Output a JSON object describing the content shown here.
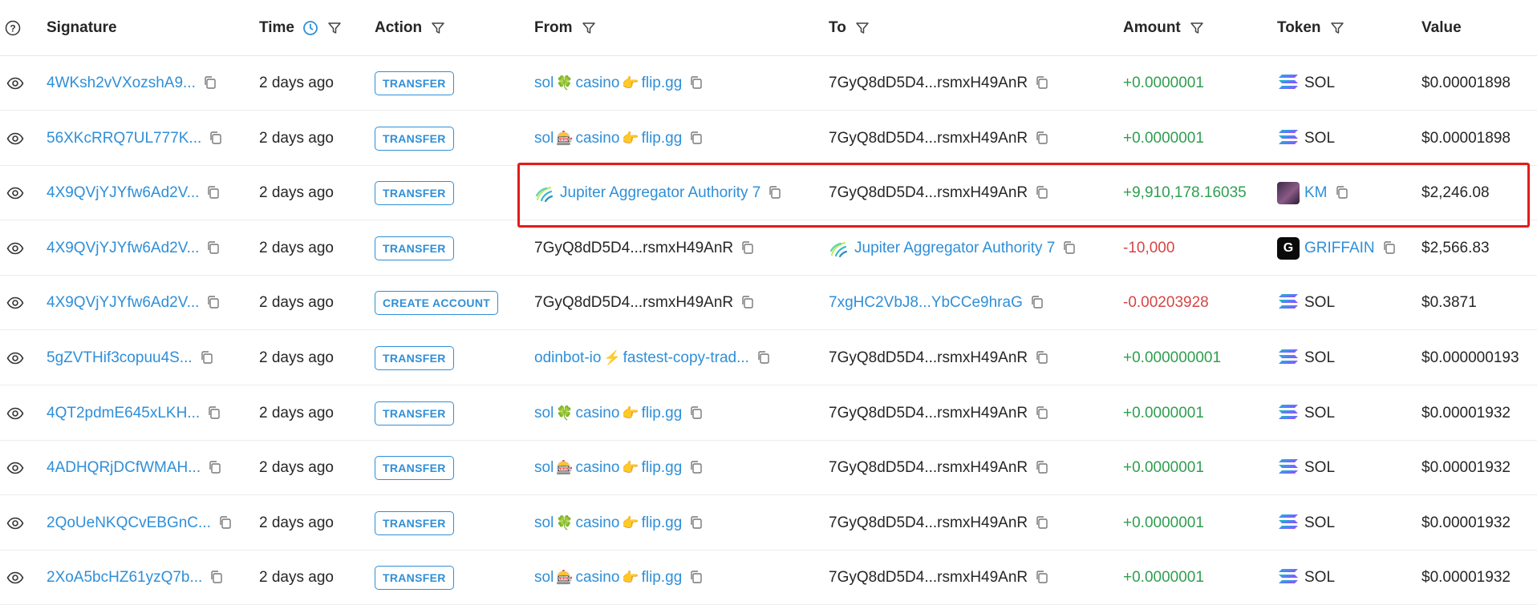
{
  "columns": {
    "signature": "Signature",
    "time": "Time",
    "action": "Action",
    "from": "From",
    "to": "To",
    "amount": "Amount",
    "token": "Token",
    "value": "Value"
  },
  "rows": [
    {
      "signature": "4WKsh2vVXozshA9...",
      "time": "2 days ago",
      "action": "TRANSFER",
      "from": {
        "parts": [
          "sol",
          "🍀",
          "casino",
          "👉",
          "flip.gg"
        ],
        "link": true
      },
      "to": {
        "text": "7GyQ8dD5D4...rsmxH49AnR",
        "link": false
      },
      "amount": "+0.0000001",
      "amount_sign": "positive",
      "token": "SOL",
      "token_icon": "solana-icon",
      "value": "$0.00001898"
    },
    {
      "signature": "56XKcRRQ7UL777K...",
      "time": "2 days ago",
      "action": "TRANSFER",
      "from": {
        "parts": [
          "sol",
          "🎰",
          "casino",
          "👉",
          "flip.gg"
        ],
        "link": true
      },
      "to": {
        "text": "7GyQ8dD5D4...rsmxH49AnR",
        "link": false
      },
      "amount": "+0.0000001",
      "amount_sign": "positive",
      "token": "SOL",
      "token_icon": "solana-icon",
      "value": "$0.00001898"
    },
    {
      "signature": "4X9QVjYJYfw6Ad2V...",
      "time": "2 days ago",
      "action": "TRANSFER",
      "from": {
        "parts": [
          "Jupiter Aggregator Authority 7"
        ],
        "link": true,
        "jupiter": true
      },
      "to": {
        "text": "7GyQ8dD5D4...rsmxH49AnR",
        "link": false
      },
      "amount": "+9,910,178.16035",
      "amount_sign": "positive",
      "token": "KM",
      "token_icon": "km-token-icon",
      "token_link": true,
      "value": "$2,246.08"
    },
    {
      "signature": "4X9QVjYJYfw6Ad2V...",
      "time": "2 days ago",
      "action": "TRANSFER",
      "from": {
        "parts": [
          "7GyQ8dD5D4...rsmxH49AnR"
        ],
        "link": false
      },
      "to": {
        "text": "Jupiter Aggregator Authority 7",
        "link": true,
        "jupiter": true
      },
      "amount": "-10,000",
      "amount_sign": "negative",
      "token": "GRIFFAIN",
      "token_icon": "griffain-token-icon",
      "token_link": true,
      "value": "$2,566.83"
    },
    {
      "signature": "4X9QVjYJYfw6Ad2V...",
      "time": "2 days ago",
      "action": "CREATE ACCOUNT",
      "from": {
        "parts": [
          "7GyQ8dD5D4...rsmxH49AnR"
        ],
        "link": false
      },
      "to": {
        "text": "7xgHC2VbJ8...YbCCe9hraG",
        "link": true
      },
      "amount": "-0.00203928",
      "amount_sign": "negative",
      "token": "SOL",
      "token_icon": "solana-icon",
      "value": "$0.3871"
    },
    {
      "signature": "5gZVTHif3copuu4S...",
      "time": "2 days ago",
      "action": "TRANSFER",
      "from": {
        "parts": [
          "odinbot-io",
          "⚡",
          "fastest-copy-trad..."
        ],
        "link": true
      },
      "to": {
        "text": "7GyQ8dD5D4...rsmxH49AnR",
        "link": false
      },
      "amount": "+0.000000001",
      "amount_sign": "positive",
      "token": "SOL",
      "token_icon": "solana-icon",
      "value": "$0.000000193"
    },
    {
      "signature": "4QT2pdmE645xLKH...",
      "time": "2 days ago",
      "action": "TRANSFER",
      "from": {
        "parts": [
          "sol",
          "🍀",
          "casino",
          "👉",
          "flip.gg"
        ],
        "link": true
      },
      "to": {
        "text": "7GyQ8dD5D4...rsmxH49AnR",
        "link": false
      },
      "amount": "+0.0000001",
      "amount_sign": "positive",
      "token": "SOL",
      "token_icon": "solana-icon",
      "value": "$0.00001932"
    },
    {
      "signature": "4ADHQRjDCfWMAH...",
      "time": "2 days ago",
      "action": "TRANSFER",
      "from": {
        "parts": [
          "sol",
          "🎰",
          "casino",
          "👉",
          "flip.gg"
        ],
        "link": true
      },
      "to": {
        "text": "7GyQ8dD5D4...rsmxH49AnR",
        "link": false
      },
      "amount": "+0.0000001",
      "amount_sign": "positive",
      "token": "SOL",
      "token_icon": "solana-icon",
      "value": "$0.00001932"
    },
    {
      "signature": "2QoUeNKQCvEBGnC...",
      "time": "2 days ago",
      "action": "TRANSFER",
      "from": {
        "parts": [
          "sol",
          "🍀",
          "casino",
          "👉",
          "flip.gg"
        ],
        "link": true
      },
      "to": {
        "text": "7GyQ8dD5D4...rsmxH49AnR",
        "link": false
      },
      "amount": "+0.0000001",
      "amount_sign": "positive",
      "token": "SOL",
      "token_icon": "solana-icon",
      "value": "$0.00001932"
    },
    {
      "signature": "2XoA5bcHZ61yzQ7b...",
      "time": "2 days ago",
      "action": "TRANSFER",
      "from": {
        "parts": [
          "sol",
          "🎰",
          "casino",
          "👉",
          "flip.gg"
        ],
        "link": true
      },
      "to": {
        "text": "7GyQ8dD5D4...rsmxH49AnR",
        "link": false
      },
      "amount": "+0.0000001",
      "amount_sign": "positive",
      "token": "SOL",
      "token_icon": "solana-icon",
      "value": "$0.00001932"
    }
  ],
  "highlighted_row": 2,
  "colors": {
    "link": "#2f8fd8",
    "positive": "#2f9e4f",
    "negative": "#d64545",
    "highlight": "#e31b1b"
  }
}
